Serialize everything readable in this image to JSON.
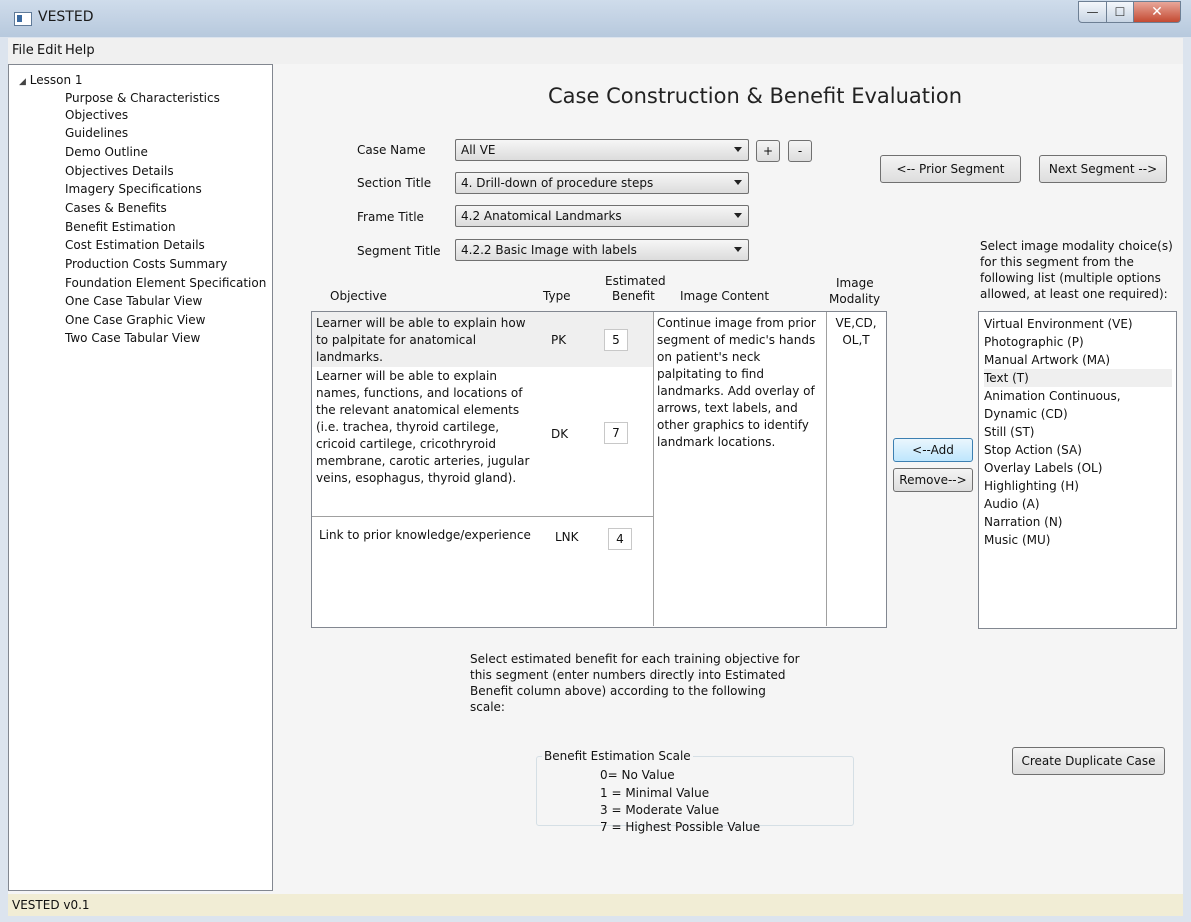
{
  "window": {
    "title": "VESTED",
    "controls": {
      "minimize": "—",
      "maximize": "☐",
      "close": "✕"
    }
  },
  "menu": {
    "file": "File",
    "edit": "Edit",
    "help": "Help"
  },
  "tree": {
    "root": "Lesson 1",
    "items": [
      "Purpose & Characteristics",
      "Objectives",
      "Guidelines",
      "Demo Outline",
      "Objectives Details",
      "Imagery Specifications",
      "Cases & Benefits",
      "Benefit Estimation",
      "Cost Estimation Details",
      "Production Costs Summary",
      "Foundation Element Specification",
      "One Case Tabular View",
      "One Case Graphic View",
      "Two Case Tabular View"
    ]
  },
  "page": {
    "title": "Case Construction & Benefit Evaluation"
  },
  "form": {
    "case_name_label": "Case Name",
    "case_name_value": "All VE",
    "add_case": "+",
    "remove_case": "-",
    "section_title_label": "Section Title",
    "section_title_value": "4. Drill-down of procedure steps",
    "frame_title_label": "Frame Title",
    "frame_title_value": "4.2 Anatomical Landmarks",
    "segment_title_label": "Segment Title",
    "segment_title_value": "4.2.2 Basic Image with labels"
  },
  "navigation": {
    "prior": "<-- Prior Segment",
    "next": "Next Segment -->"
  },
  "table": {
    "headers": {
      "objective": "Objective",
      "type": "Type",
      "benefit_1": "Estimated",
      "benefit_2": "Benefit",
      "image_content": "Image Content",
      "modality_1": "Image",
      "modality_2": "Modality"
    },
    "rows": [
      {
        "objective": "Learner will be able to explain how to palpitate for anatomical landmarks.",
        "type": "PK",
        "benefit": "5"
      },
      {
        "objective": "Learner will be able to explain names, functions, and locations of the relevant anatomical elements (i.e. trachea, thyroid cartilege, cricoid cartilege, cricothryroid membrane, carotic arteries, jugular veins, esophagus, thyroid gland).",
        "type": "DK",
        "benefit": "7"
      },
      {
        "objective": "Link to prior knowledge/experience",
        "type": "LNK",
        "benefit": "4"
      }
    ],
    "image_content": "Continue image from prior segment of medic's hands on patient's neck palpitating to find landmarks. Add overlay of arrows, text labels, and other graphics to identify landmark locations.",
    "modality": "VE,CD, OL,T"
  },
  "modality_panel": {
    "instruction": "Select image modality choice(s) for this segment from the following list (multiple options allowed, at least one required):",
    "add": "<--Add",
    "remove": "Remove-->",
    "options": [
      "Virtual Environment (VE)",
      "Photographic (P)",
      "Manual Artwork (MA)",
      "Text (T)",
      "Animation Continuous,",
      "Dynamic (CD)",
      "Still (ST)",
      "Stop Action (SA)",
      "Overlay Labels (OL)",
      "Highlighting (H)",
      "Audio (A)",
      "Narration (N)",
      "Music (MU)"
    ]
  },
  "benefit_help": {
    "instruction": "Select estimated benefit for each training objective for this segment (enter numbers directly into Estimated Benefit column above) according to the following scale:",
    "group_title": "Benefit Estimation Scale",
    "scale": [
      "0= No Value",
      "1 = Minimal Value",
      "3 = Moderate Value",
      "7 = Highest Possible Value"
    ]
  },
  "duplicate_button": "Create Duplicate Case",
  "status": "VESTED v0.1"
}
